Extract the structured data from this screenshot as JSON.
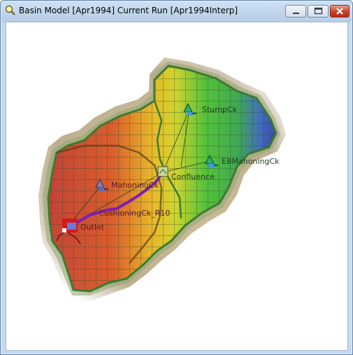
{
  "window": {
    "title": "Basin Model [Apr1994] Current Run [Apr1994Interp]",
    "icons": {
      "app": "hec-hms-app-icon",
      "minimize": "minimize-icon",
      "maximize": "maximize-icon",
      "close": "close-icon"
    }
  },
  "map": {
    "elements": {
      "stump": "StumpCk",
      "eb": "EBMahoningCk",
      "mahoning": "MahoningCk",
      "confluence": "Confluence",
      "reach": "CushioningCk_R10",
      "outlet": "Outlet"
    },
    "colors": {
      "label": "#1f3a1f",
      "outlet_label": "#6a1010",
      "reach": "#7a1fb0",
      "boundary": "#3d7a2e"
    }
  }
}
